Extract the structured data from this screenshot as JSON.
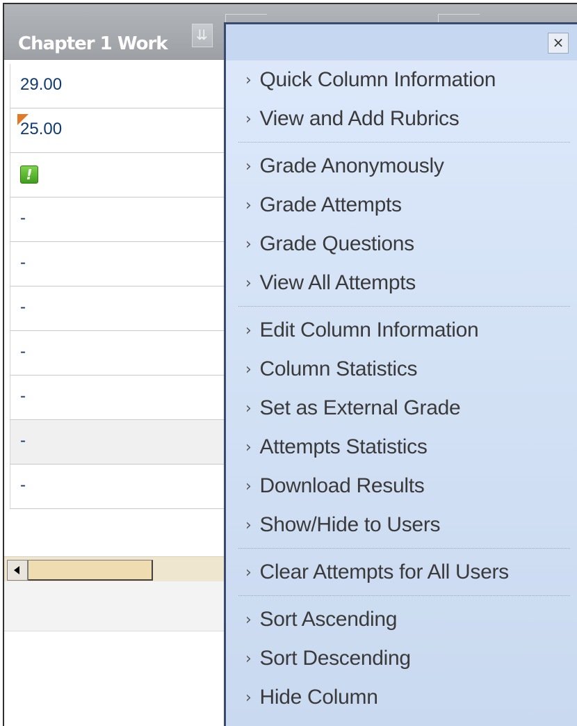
{
  "column": {
    "title": "Chapter 1 Work",
    "menu_icon": "chevron-down-double-icon"
  },
  "cells": [
    {
      "text": "29.00"
    },
    {
      "text": "25.00",
      "needs_attention": true
    },
    {
      "icon": "needs-grading-icon",
      "glyph": "!"
    },
    {
      "text": "-"
    },
    {
      "text": "-"
    },
    {
      "text": "-"
    },
    {
      "text": "-"
    },
    {
      "text": "-"
    },
    {
      "text": "-"
    },
    {
      "text": "-"
    }
  ],
  "menu": {
    "close_label": "×",
    "groups": [
      [
        "Quick Column Information",
        "View and Add Rubrics"
      ],
      [
        "Grade Anonymously",
        "Grade Attempts",
        "Grade Questions",
        "View All Attempts"
      ],
      [
        "Edit Column Information",
        "Column Statistics",
        "Set as External Grade",
        "Attempts Statistics",
        "Download Results",
        "Show/Hide to Users"
      ],
      [
        "Clear Attempts for All Users"
      ],
      [
        "Sort Ascending",
        "Sort Descending",
        "Hide Column"
      ]
    ]
  },
  "colors": {
    "header": "#a3a7ac",
    "menu_bg": "#d3e1f5",
    "cell_text": "#103a72",
    "needs_grading": "#4cae24",
    "attention_marker": "#e07a2a"
  }
}
